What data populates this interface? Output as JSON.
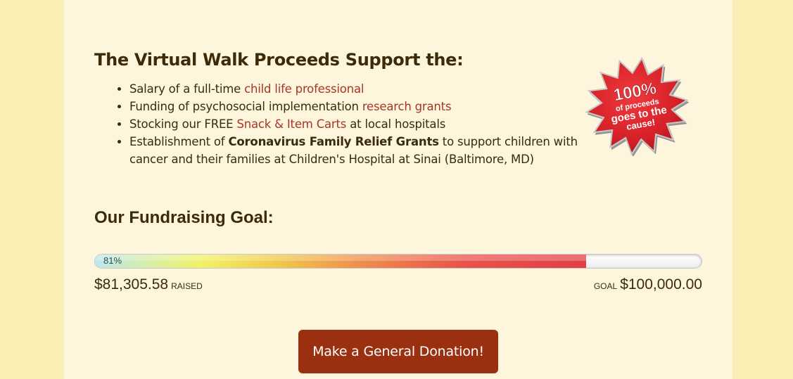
{
  "support": {
    "heading": "The Virtual Walk Proceeds Support the:",
    "items": [
      {
        "pre": "Salary of a full-time ",
        "link": "child life professional",
        "post": ""
      },
      {
        "pre": "Funding of psychosocial implementation ",
        "link": "research grants",
        "post": ""
      },
      {
        "pre": "Stocking our FREE ",
        "link": "Snack & Item Carts",
        "post": " at local hospitals"
      },
      {
        "pre": "Establishment of ",
        "strong": "Coronavirus Family Relief Grants",
        "post": " to support children with cancer and their families at Children's Hospital at Sinai (Baltimore, MD)"
      }
    ]
  },
  "badge": {
    "line1": "100%",
    "line2": "of proceeds",
    "line3": "goes to the",
    "line4": "cause!",
    "icon": "starburst-badge-icon",
    "color": "#d62027"
  },
  "fundraising": {
    "heading": "Our Fundraising Goal:",
    "percent_label": "81%",
    "progress_fraction": 0.81,
    "raised_amount": "$81,305.58",
    "raised_label": "RAISED",
    "goal_label": "GOAL",
    "goal_amount": "$100,000.00"
  },
  "donate": {
    "label": "Make a General Donation!",
    "color": "#9b3010"
  },
  "colors": {
    "page_background": "#fbeeb4",
    "panel_background": "#fdf6dc",
    "heading_text": "#3d2a08",
    "link": "#a6352a"
  }
}
